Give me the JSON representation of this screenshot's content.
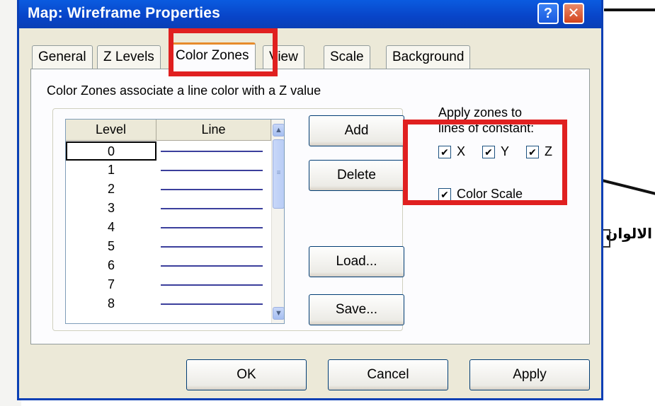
{
  "window": {
    "title": "Map: Wireframe Properties",
    "help_label": "?",
    "close_label": "✕"
  },
  "tabs": [
    {
      "label": "General"
    },
    {
      "label": "Z Levels"
    },
    {
      "label": "Color Zones"
    },
    {
      "label": "View"
    },
    {
      "label": "Scale"
    },
    {
      "label": "Background"
    }
  ],
  "active_tab": "Color Zones",
  "panel": {
    "description": "Color Zones associate a line color with a Z value",
    "grid": {
      "columns": [
        "Level",
        "Line"
      ],
      "levels": [
        "0",
        "1",
        "2",
        "3",
        "4",
        "5",
        "6",
        "7",
        "8"
      ],
      "line_color": "#3b3f9c"
    },
    "buttons": {
      "add": "Add",
      "delete": "Delete",
      "load": "Load...",
      "save": "Save..."
    },
    "apply_caption_1": "Apply zones to",
    "apply_caption_2": "lines of constant:",
    "axes": [
      {
        "label": "X",
        "checked": true
      },
      {
        "label": "Y",
        "checked": true
      },
      {
        "label": "Z",
        "checked": true
      }
    ],
    "color_scale": {
      "label": "Color Scale",
      "checked": true
    }
  },
  "footer": {
    "ok": "OK",
    "cancel": "Cancel",
    "apply": "Apply"
  },
  "background_text": "الالوان",
  "colors": {
    "titlebar": "#0a4fd6",
    "dialog_face": "#ece9d8",
    "highlight": "#e02020"
  }
}
